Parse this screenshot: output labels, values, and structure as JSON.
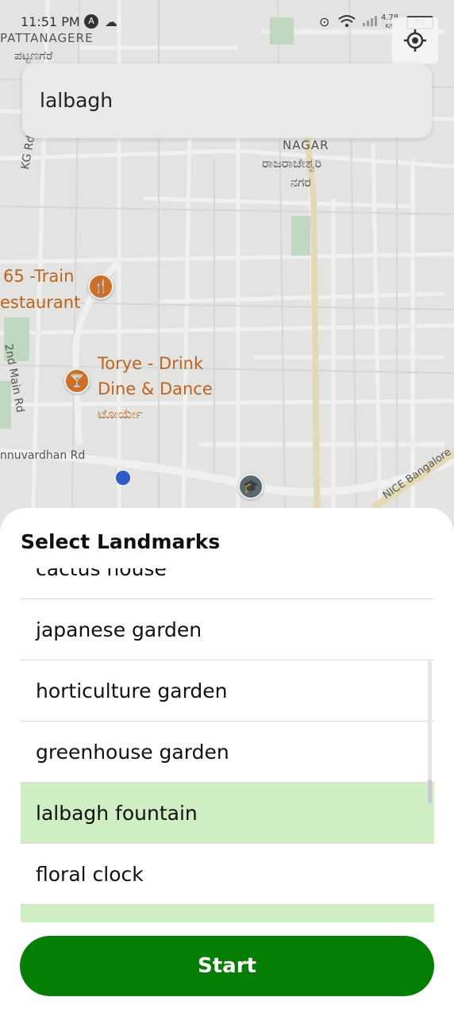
{
  "status_bar": {
    "time": "11:51 PM",
    "net_speed_value": "4.78",
    "net_speed_unit": "K/S",
    "battery": "89"
  },
  "map": {
    "labels": {
      "pattanagere_en": "PATTANAGERE",
      "pattanagere_kn": "ಪಟ್ಟಣಗೆರೆ",
      "nagar_en": "NAGAR",
      "rajarajeshwari_kn": "ರಾಜರಾಜೇಶ್ವರಿ",
      "nagara_kn": "ನಗರ",
      "kg_rd": "KG Rd",
      "second_main_rd": "2nd Main Rd",
      "vardhan_rd": "nnuvardhan Rd",
      "nice_road": "NICE Bangalore"
    },
    "pois": {
      "train_restaurant_line1": "65 -Train",
      "train_restaurant_line2": "estaurant",
      "torye_line1": "Torye - Drink",
      "torye_line2": "Dine & Dance",
      "torye_kn": "ಟೋರ್ಯೇ"
    }
  },
  "search": {
    "value": "lalbagh"
  },
  "sheet": {
    "title": "Select Landmarks",
    "items": [
      {
        "label": "cactus house",
        "selected": false
      },
      {
        "label": "japanese garden",
        "selected": false
      },
      {
        "label": "horticulture garden",
        "selected": false
      },
      {
        "label": "greenhouse garden",
        "selected": false
      },
      {
        "label": "lalbagh fountain",
        "selected": true
      },
      {
        "label": "floral clock",
        "selected": false
      },
      {
        "label": "",
        "selected": true
      }
    ],
    "start_label": "Start"
  },
  "colors": {
    "accent": "#047f03",
    "selected_row": "#cfeec4",
    "poi": "#c86a1e",
    "user_location": "#2f62d6"
  }
}
